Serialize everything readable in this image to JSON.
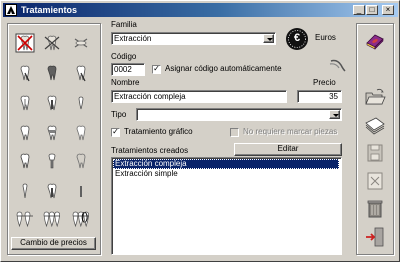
{
  "window": {
    "title": "Tratamientos"
  },
  "titlebar_buttons": {
    "minimize": "_",
    "maximize": "□",
    "close": "×"
  },
  "form": {
    "familia_label": "Familia",
    "familia_value": "Extracción",
    "currency_symbol": "€",
    "currency_label": "Euros",
    "codigo_label": "Código",
    "codigo_value": "0002",
    "asignar_label": "Asignar código automáticamente",
    "asignar_checked": true,
    "nombre_label": "Nombre",
    "nombre_value": "Extracción compleja",
    "precio_label": "Precio",
    "precio_value": "35",
    "tipo_label": "Tipo",
    "tipo_value": "",
    "grafico_label": "Tratamiento gráfico",
    "grafico_checked": true,
    "no_requiere_label": "No requiere marcar piezas",
    "no_requiere_checked": false,
    "creados_label": "Tratamientos creados",
    "editar_label": "Editar"
  },
  "treatments_list": [
    "Extracción compleja",
    "Extracción simple"
  ],
  "selected_treatment": "Extracción compleja",
  "left_panel": {
    "cambio_precios_label": "Cambio de precios",
    "last_glyph_text": "()"
  },
  "colors": {
    "titlebar_start": "#0a246a",
    "titlebar_end": "#a6caf0",
    "selection": "#0a246a",
    "tooth_red": "#cc0000",
    "book_purple": "#8a2b8a"
  },
  "icons": [
    "tooth-x-red-icon",
    "tooth-x-gray-icon",
    "tooth-crossed-icon",
    "tooth-with-pin-icon",
    "tooth-filled-crown-icon",
    "tooth-with-pin-2-icon",
    "tooth-root-canal-icon",
    "tooth-post-icon",
    "tooth-implant-small-icon",
    "tooth-double-root-icon",
    "tooth-bracket-icon",
    "tooth-white-icon",
    "tooth-crown-icon",
    "tooth-implant-icon",
    "tooth-partial-icon",
    "tooth-single-root-icon",
    "tooth-post-2-icon",
    "tooth-bar-icon",
    "teeth-bridge-icon",
    "teeth-triple-bridge-icon",
    "teeth-multi-bridge-icon",
    "denture-icon",
    "tooth-broken-icon",
    "tooth-parentheses-icon",
    "euro-coin-icon",
    "instrument-icon",
    "book-icon",
    "folder-open-icon",
    "pages-icon",
    "save-disk-icon",
    "edit-document-icon",
    "trash-icon",
    "exit-door-icon"
  ]
}
